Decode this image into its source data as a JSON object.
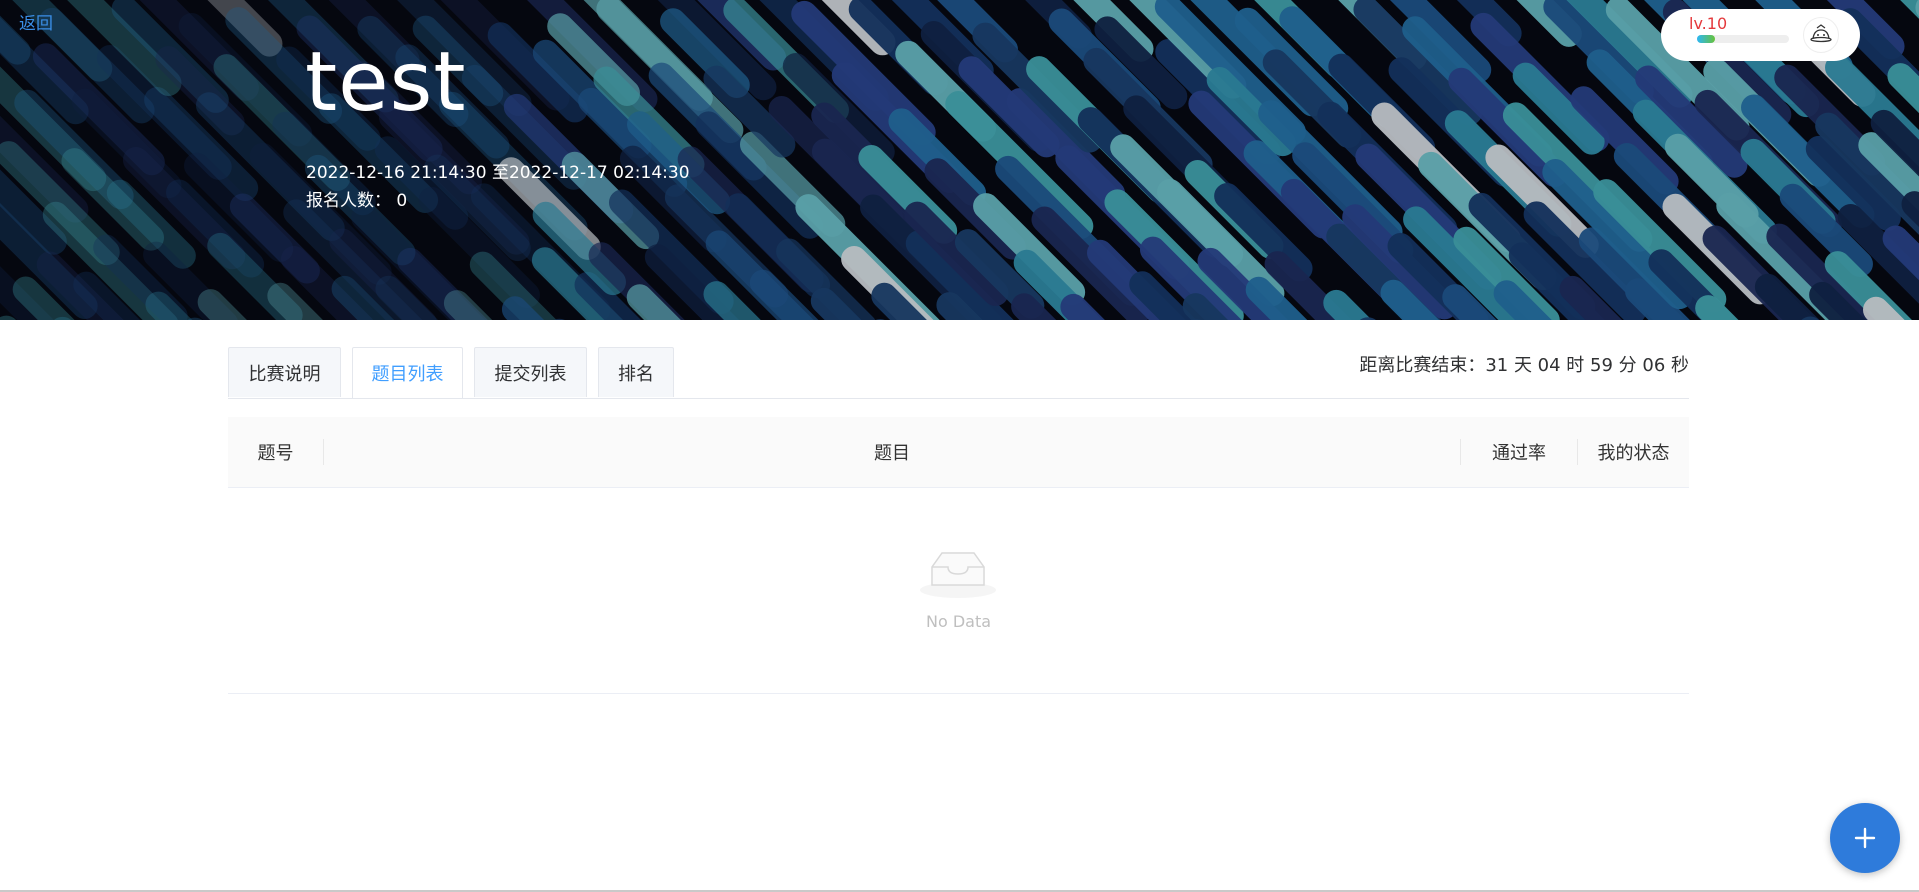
{
  "header": {
    "back_label": "返回",
    "title": "test",
    "time_range": "2022-12-16 21:14:30 至2022-12-17 02:14:30",
    "signup_label": "报名人数：",
    "signup_count": "0"
  },
  "user": {
    "level": "lv.10",
    "level_progress": 0.2,
    "avatar_icon": "user-avatar-icon"
  },
  "tabs": [
    {
      "label": "比赛说明",
      "active": false
    },
    {
      "label": "题目列表",
      "active": true
    },
    {
      "label": "提交列表",
      "active": false
    },
    {
      "label": "排名",
      "active": false
    }
  ],
  "countdown": "距离比赛结束：31 天 04 时 59 分 06 秒",
  "table": {
    "columns": [
      "题号",
      "题目",
      "通过率",
      "我的状态"
    ],
    "rows": [],
    "empty_text": "No Data",
    "empty_icon": "inbox-icon"
  },
  "fab_icon": "plus-icon",
  "colors": {
    "accent": "#409eff",
    "level_text": "#e4393c",
    "fab": "#2e7bdb"
  }
}
